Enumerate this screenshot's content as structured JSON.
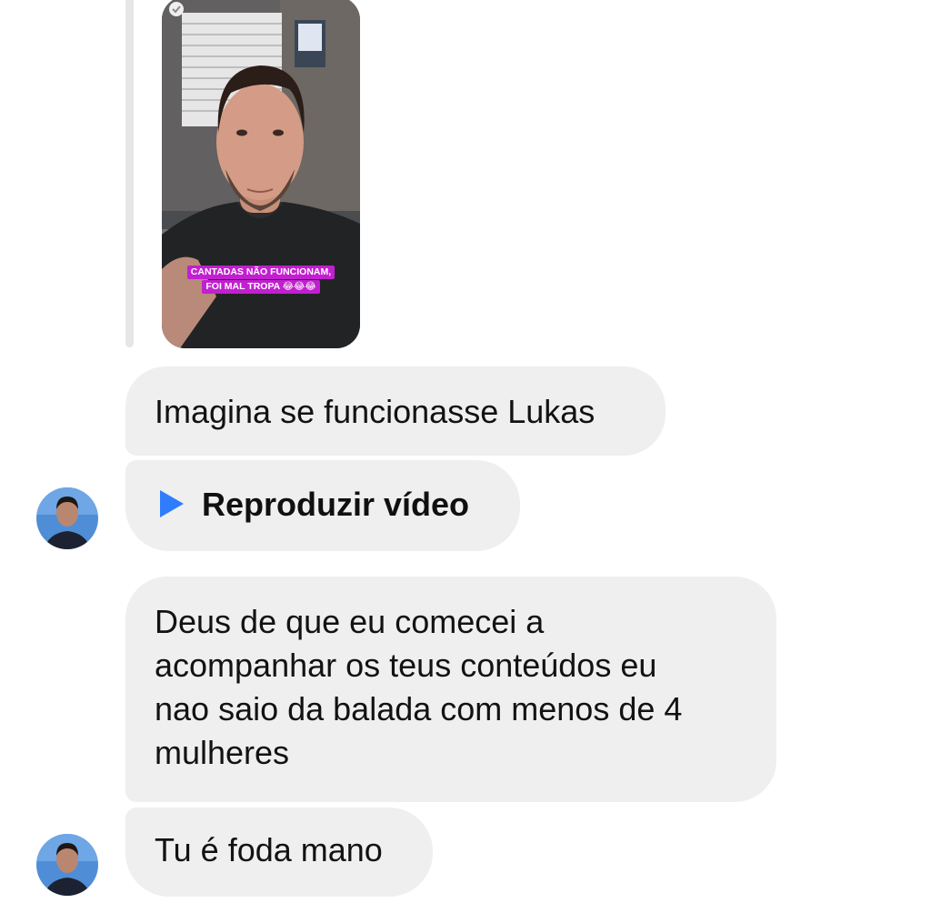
{
  "reply": {
    "story_caption_line1": "CANTADAS NÃO FUNCIONAM,",
    "story_caption_line2": "FOI MAL TROPA 😂😂😂"
  },
  "messages": [
    {
      "type": "text",
      "text": "Imagina se funcionasse Lukas"
    },
    {
      "type": "video",
      "label": "Reproduzir vídeo",
      "icon": "play-icon"
    },
    {
      "type": "text",
      "lines": [
        "Deus de que eu comecei a",
        "acompanhar os teus conteúdos eu",
        "nao saio da balada com menos de 4",
        "mulheres"
      ]
    },
    {
      "type": "text",
      "text": "Tu é foda mano"
    }
  ],
  "colors": {
    "bubble": "#efefef",
    "play": "#2f7dfd",
    "caption_highlight": "#c21fd0",
    "reply_bar": "#e6e6e6"
  }
}
